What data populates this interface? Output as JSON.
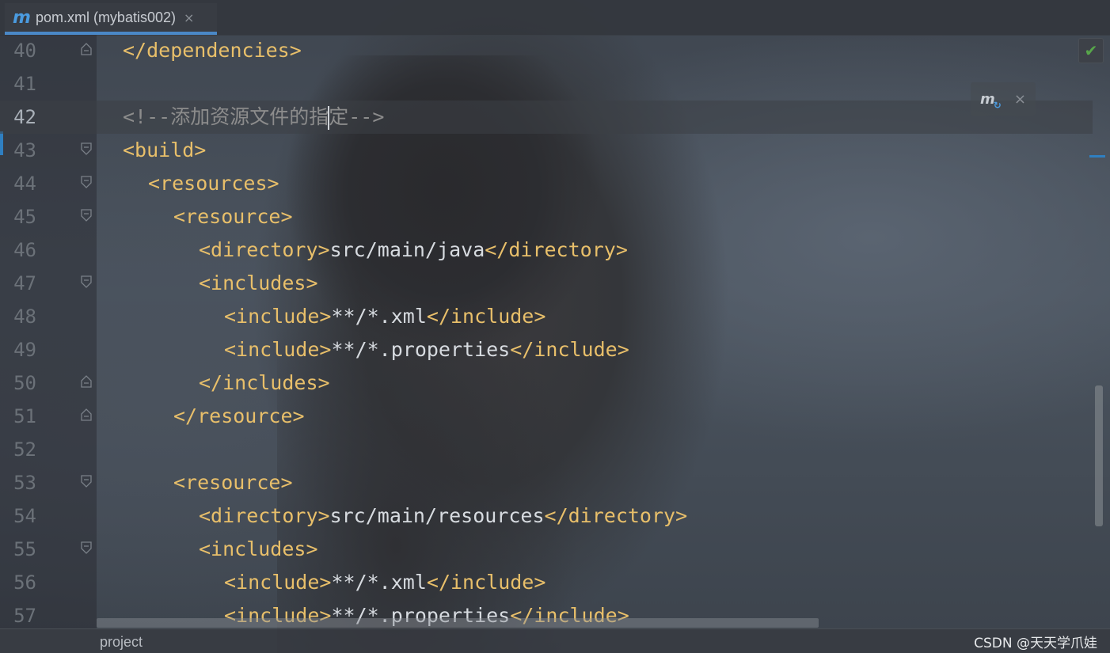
{
  "tab": {
    "icon": "maven-m-icon",
    "label": "pom.xml (mybatis002)",
    "close": "×"
  },
  "lines": [
    {
      "n": "40",
      "fold": "end",
      "indent": 0,
      "parts": [
        {
          "t": "tag",
          "v": "</dependencies>"
        }
      ]
    },
    {
      "n": "41",
      "fold": "",
      "indent": 0,
      "parts": []
    },
    {
      "n": "42",
      "fold": "",
      "indent": 0,
      "current": true,
      "parts": [
        {
          "t": "cmt",
          "v": "<!--添加资源文件的指"
        },
        {
          "t": "caret",
          "v": ""
        },
        {
          "t": "cmt",
          "v": "定-->"
        }
      ]
    },
    {
      "n": "43",
      "fold": "start",
      "indent": 0,
      "parts": [
        {
          "t": "tag",
          "v": "<build>"
        }
      ]
    },
    {
      "n": "44",
      "fold": "start",
      "indent": 1,
      "parts": [
        {
          "t": "tag",
          "v": "<resources>"
        }
      ]
    },
    {
      "n": "45",
      "fold": "start",
      "indent": 2,
      "parts": [
        {
          "t": "tag",
          "v": "<resource>"
        }
      ]
    },
    {
      "n": "46",
      "fold": "",
      "indent": 3,
      "parts": [
        {
          "t": "tag",
          "v": "<directory>"
        },
        {
          "t": "txt",
          "v": "src/main/java"
        },
        {
          "t": "tag",
          "v": "</directory>"
        }
      ]
    },
    {
      "n": "47",
      "fold": "start",
      "indent": 3,
      "parts": [
        {
          "t": "tag",
          "v": "<includes>"
        }
      ]
    },
    {
      "n": "48",
      "fold": "",
      "indent": 4,
      "parts": [
        {
          "t": "tag",
          "v": "<include>"
        },
        {
          "t": "txt",
          "v": "**/*.xml"
        },
        {
          "t": "tag",
          "v": "</include>"
        }
      ]
    },
    {
      "n": "49",
      "fold": "",
      "indent": 4,
      "parts": [
        {
          "t": "tag",
          "v": "<include>"
        },
        {
          "t": "txt",
          "v": "**/*.properties"
        },
        {
          "t": "tag",
          "v": "</include>"
        }
      ]
    },
    {
      "n": "50",
      "fold": "end",
      "indent": 3,
      "parts": [
        {
          "t": "tag",
          "v": "</includes>"
        }
      ]
    },
    {
      "n": "51",
      "fold": "end",
      "indent": 2,
      "parts": [
        {
          "t": "tag",
          "v": "</resource>"
        }
      ]
    },
    {
      "n": "52",
      "fold": "",
      "indent": 0,
      "parts": []
    },
    {
      "n": "53",
      "fold": "start",
      "indent": 2,
      "parts": [
        {
          "t": "tag",
          "v": "<resource>"
        }
      ]
    },
    {
      "n": "54",
      "fold": "",
      "indent": 3,
      "parts": [
        {
          "t": "tag",
          "v": "<directory>"
        },
        {
          "t": "txt",
          "v": "src/main/resources"
        },
        {
          "t": "tag",
          "v": "</directory>"
        }
      ]
    },
    {
      "n": "55",
      "fold": "start",
      "indent": 3,
      "parts": [
        {
          "t": "tag",
          "v": "<includes>"
        }
      ]
    },
    {
      "n": "56",
      "fold": "",
      "indent": 4,
      "parts": [
        {
          "t": "tag",
          "v": "<include>"
        },
        {
          "t": "txt",
          "v": "**/*.xml"
        },
        {
          "t": "tag",
          "v": "</include>"
        }
      ]
    },
    {
      "n": "57",
      "fold": "",
      "indent": 4,
      "parts": [
        {
          "t": "tag",
          "v": "<include>"
        },
        {
          "t": "txt",
          "v": "**/*.properties"
        },
        {
          "t": "tag",
          "v": "</include>"
        }
      ]
    }
  ],
  "inspection_status": "✔",
  "maven_popup": {
    "icon": "m",
    "sync_icon": "↻",
    "close": "×"
  },
  "breadcrumb": "project",
  "watermark": "CSDN @天天学爪娃",
  "colors": {
    "tag": "#e8bf6a",
    "text": "#d7dbe0",
    "comment": "#8c8c8c",
    "accent": "#4a88c7",
    "ok": "#57a64a"
  }
}
